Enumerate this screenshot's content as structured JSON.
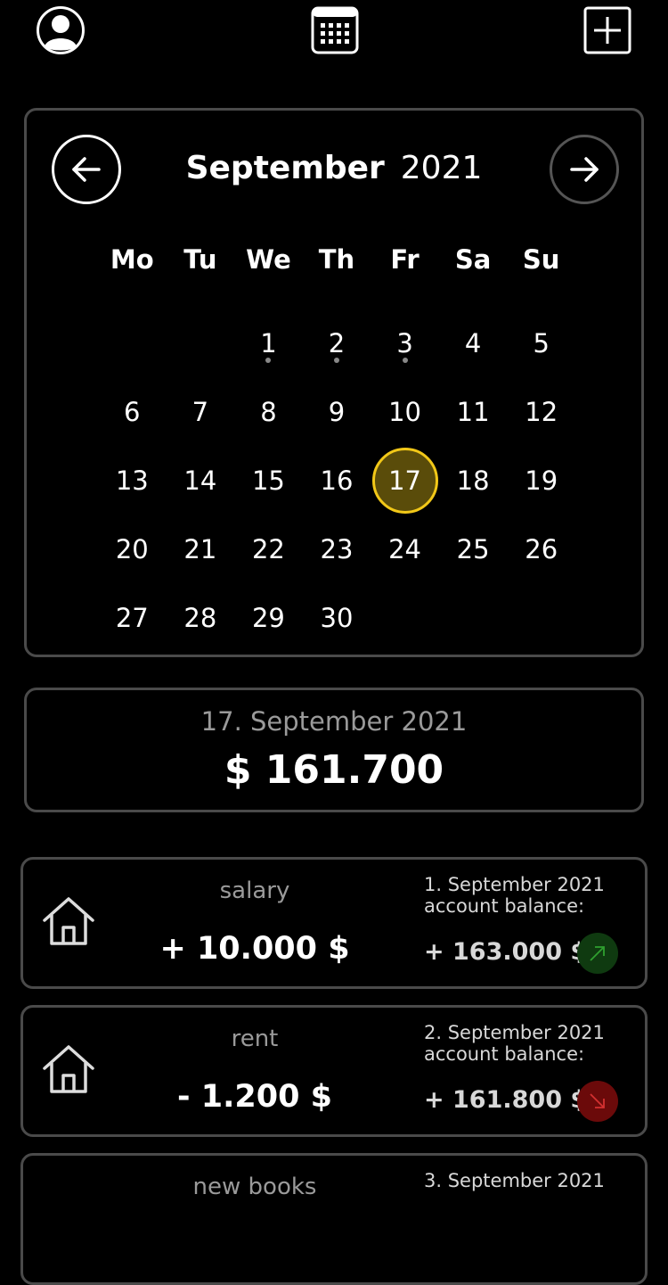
{
  "topbar": {
    "profile_icon": "user-circle-icon",
    "calendar_icon": "calendar-icon",
    "add_icon": "plus-square-icon"
  },
  "calendar": {
    "month": "September",
    "year": "2021",
    "weekdays": [
      "Mo",
      "Tu",
      "We",
      "Th",
      "Fr",
      "Sa",
      "Su"
    ],
    "days": [
      {
        "d": "",
        "dot": false
      },
      {
        "d": "",
        "dot": false
      },
      {
        "d": "1",
        "dot": true
      },
      {
        "d": "2",
        "dot": true
      },
      {
        "d": "3",
        "dot": true
      },
      {
        "d": "4",
        "dot": false
      },
      {
        "d": "5",
        "dot": false
      },
      {
        "d": "6",
        "dot": false
      },
      {
        "d": "7",
        "dot": false
      },
      {
        "d": "8",
        "dot": false
      },
      {
        "d": "9",
        "dot": false
      },
      {
        "d": "10",
        "dot": false
      },
      {
        "d": "11",
        "dot": false
      },
      {
        "d": "12",
        "dot": false
      },
      {
        "d": "13",
        "dot": false
      },
      {
        "d": "14",
        "dot": false
      },
      {
        "d": "15",
        "dot": false
      },
      {
        "d": "16",
        "dot": false
      },
      {
        "d": "17",
        "dot": false,
        "selected": true
      },
      {
        "d": "18",
        "dot": false
      },
      {
        "d": "19",
        "dot": false
      },
      {
        "d": "20",
        "dot": false
      },
      {
        "d": "21",
        "dot": false
      },
      {
        "d": "22",
        "dot": false
      },
      {
        "d": "23",
        "dot": false
      },
      {
        "d": "24",
        "dot": false
      },
      {
        "d": "25",
        "dot": false
      },
      {
        "d": "26",
        "dot": false
      },
      {
        "d": "27",
        "dot": false
      },
      {
        "d": "28",
        "dot": false
      },
      {
        "d": "29",
        "dot": false
      },
      {
        "d": "30",
        "dot": false
      }
    ],
    "selected_color": "#f2c818"
  },
  "summary": {
    "date": "17. September 2021",
    "amount": "$ 161.700"
  },
  "transactions": [
    {
      "name": "salary",
      "amount": "+ 10.000 $",
      "date": "1. September 2021",
      "balance_label": "account balance:",
      "balance": "+ 163.000 $",
      "trend": "up"
    },
    {
      "name": "rent",
      "amount": "- 1.200 $",
      "date": "2. September 2021",
      "balance_label": "account balance:",
      "balance": "+ 161.800 $",
      "trend": "down"
    },
    {
      "name": "new books",
      "amount": "",
      "date": "3. September 2021",
      "balance_label": "",
      "balance": "",
      "trend": ""
    }
  ]
}
